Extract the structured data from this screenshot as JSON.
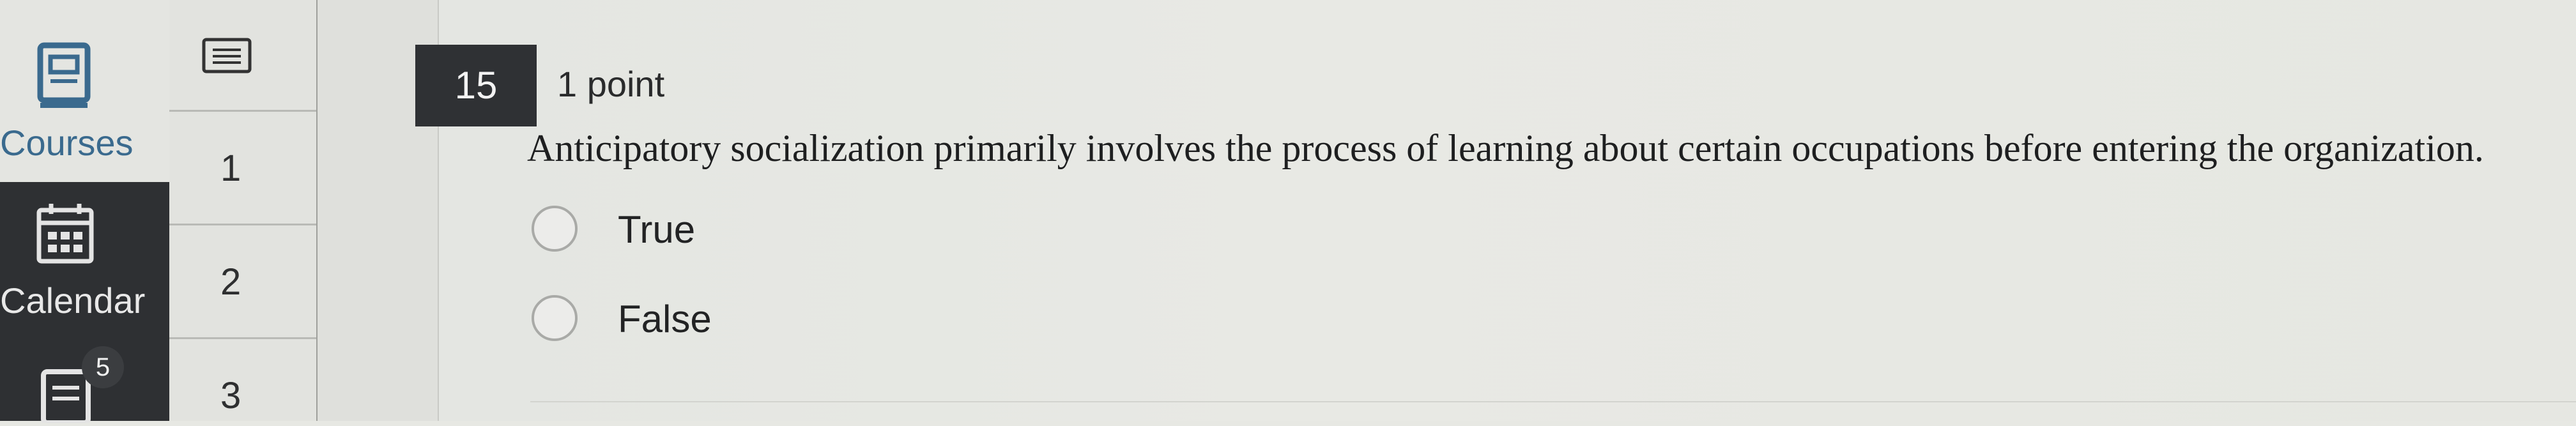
{
  "global_nav": {
    "items": [
      {
        "label": "Courses",
        "icon": "courses-book-icon",
        "active": true
      },
      {
        "label": "Calendar",
        "icon": "calendar-icon",
        "active": false
      },
      {
        "label": "",
        "icon": "inbox-icon",
        "badge": "5",
        "active": false
      }
    ]
  },
  "question_nav": {
    "cells": [
      {
        "label": "",
        "icon": "question-list-icon"
      },
      {
        "label": "1"
      },
      {
        "label": "2"
      },
      {
        "label": "3"
      }
    ]
  },
  "question": {
    "number": "15",
    "points": "1 point",
    "text": "Anticipatory socialization primarily involves the process of learning about certain occupations before entering the organization.",
    "options": [
      {
        "label": "True",
        "selected": false
      },
      {
        "label": "False",
        "selected": false
      }
    ]
  },
  "colors": {
    "nav_background": "#2e3033",
    "active_label": "#3a6a8e",
    "question_number_bg": "#2f3134"
  }
}
